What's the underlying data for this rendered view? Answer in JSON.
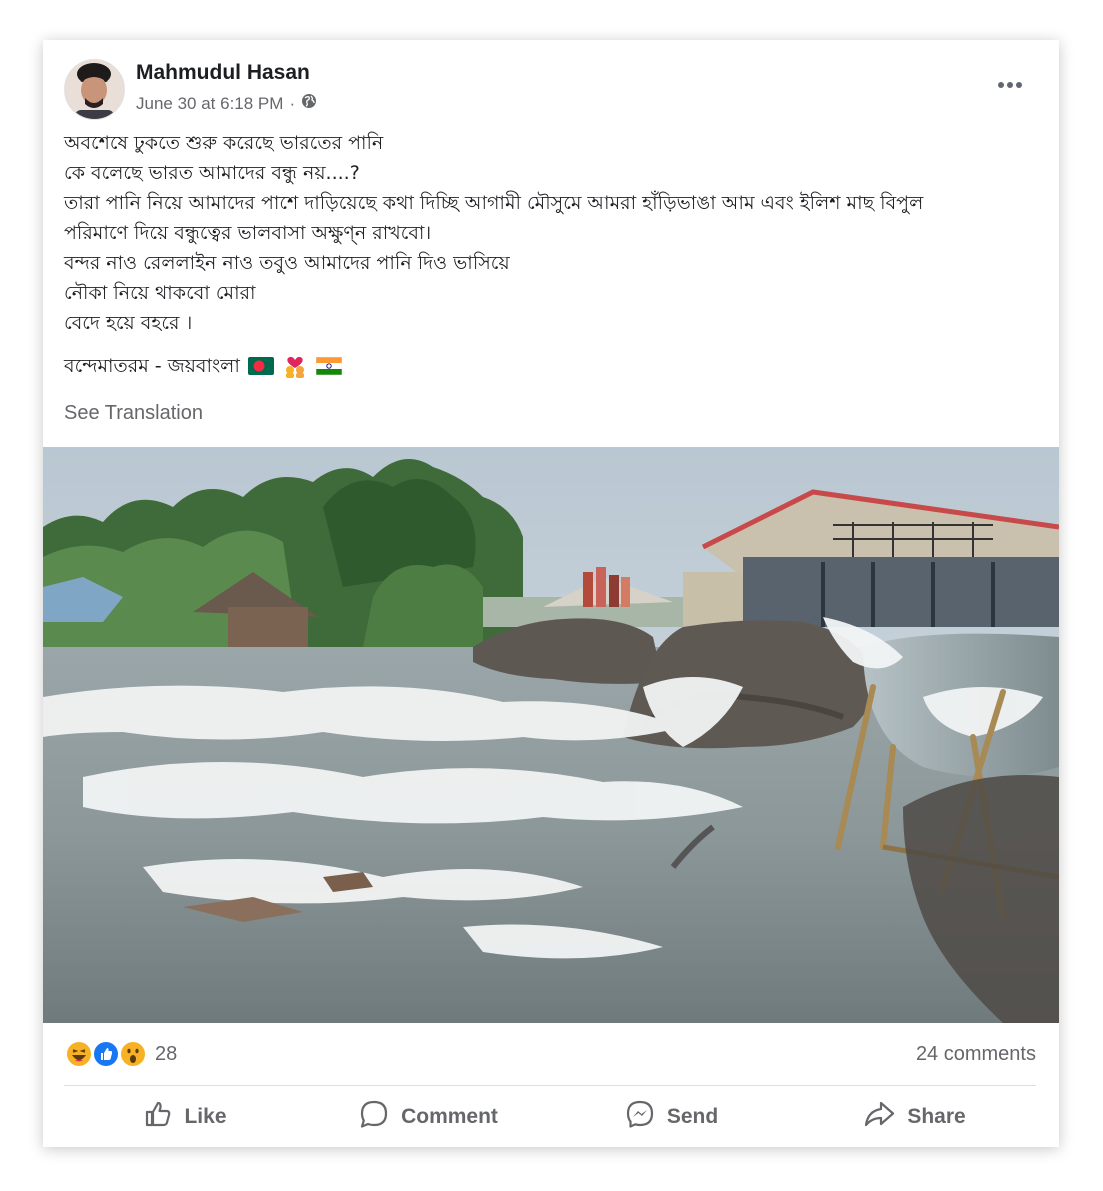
{
  "post": {
    "author": "Mahmudul Hasan",
    "timestamp": "June 30 at 6:18 PM",
    "separator": "·",
    "privacy_icon": "globe-icon",
    "more_icon": "more-options-icon",
    "text_lines": [
      "অবশেষে ঢুকতে শুরু করেছে ভারতের পানি",
      "কে বলেছে ভারত আমাদের বন্ধু নয়....?",
      "তারা পানি নিয়ে আমাদের পাশে দাড়িয়েছে কথা দিচ্ছি আগামী মৌসুমে আমরা হাঁড়িভাঙা আম এবং ইলিশ মাছ বিপুল",
      "পরিমাণে দিয়ে বন্ধুত্বের ভালবাসা অক্ষুণ্ন রাখবো।",
      "বন্দর নাও রেললাইন নাও তবুও আমাদের পানি দিও ভাসিয়ে",
      "নৌকা নিয়ে থাকবো মোরা",
      "বেদে হয়ে বহরে ।"
    ],
    "signature": "বন্দেমাতরম - জয়বাংলা",
    "signature_emojis": [
      "bangladesh-flag",
      "couple-with-heart",
      "india-flag"
    ],
    "see_translation": "See Translation"
  },
  "engagement": {
    "reaction_icons": [
      "haha-icon",
      "like-icon",
      "wow-icon"
    ],
    "reaction_count": "28",
    "comments": "24 comments"
  },
  "actions": [
    {
      "label": "Like",
      "icon": "thumbs-up-icon"
    },
    {
      "label": "Comment",
      "icon": "comment-icon"
    },
    {
      "label": "Send",
      "icon": "messenger-icon"
    },
    {
      "label": "Share",
      "icon": "share-icon"
    }
  ],
  "colors": {
    "text": "#1c1e21",
    "secondary": "#65676b",
    "like_blue": "#1877f2",
    "haha_yellow": "#f7b125"
  }
}
